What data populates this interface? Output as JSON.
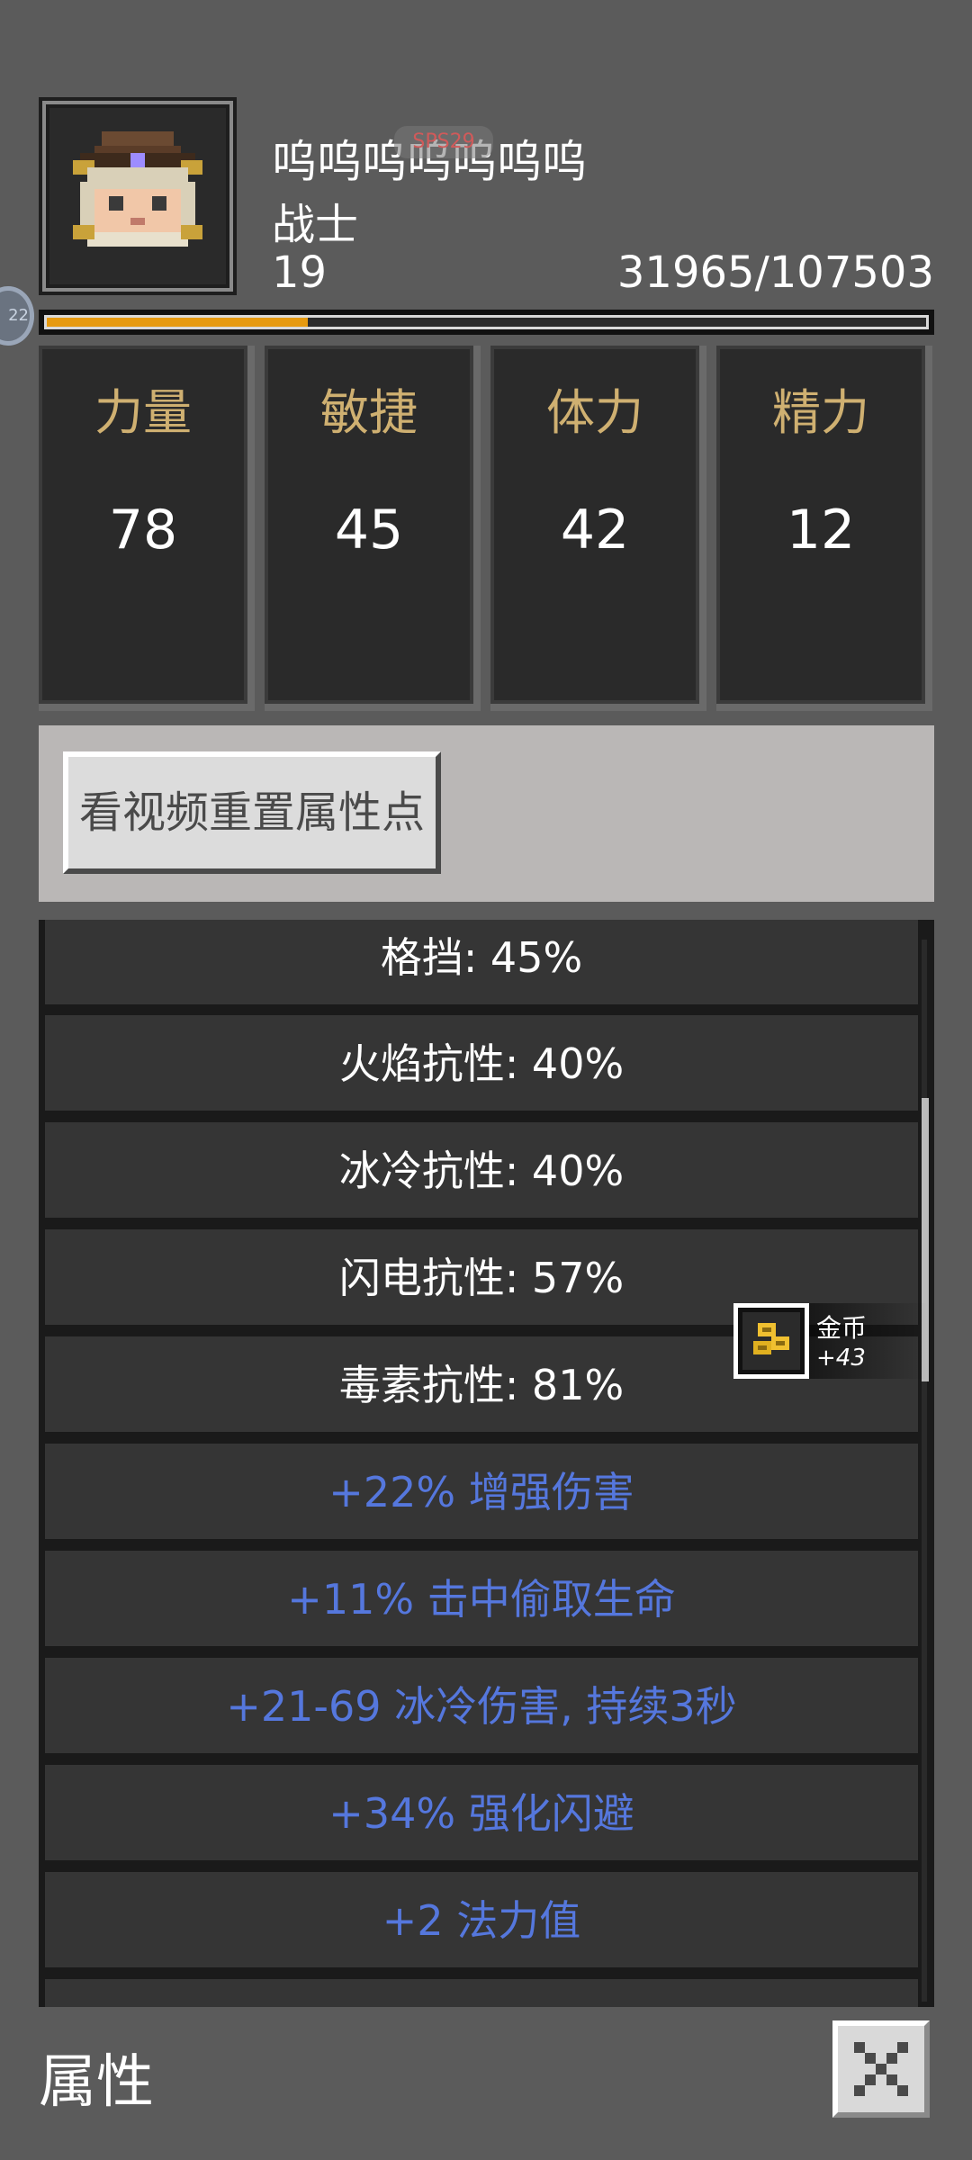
{
  "character": {
    "name": "呜呜呜呜呜呜呜",
    "watermark": "SPS29",
    "class": "战士",
    "level": "19",
    "experience": "31965/107503",
    "experience_fraction": 0.297
  },
  "side_badge": {
    "label": "22"
  },
  "stats": [
    {
      "label": "力量",
      "value": "78"
    },
    {
      "label": "敏捷",
      "value": "45"
    },
    {
      "label": "体力",
      "value": "42"
    },
    {
      "label": "精力",
      "value": "12"
    }
  ],
  "reset_button": {
    "label": "看视频重置属性点"
  },
  "attributes": [
    {
      "text": "格挡: 45%",
      "style": "white"
    },
    {
      "text": "火焰抗性: 40%",
      "style": "white"
    },
    {
      "text": "冰冷抗性: 40%",
      "style": "white"
    },
    {
      "text": "闪电抗性: 57%",
      "style": "white"
    },
    {
      "text": "毒素抗性: 81%",
      "style": "white"
    },
    {
      "text": "+22% 增强伤害",
      "style": "blue"
    },
    {
      "text": "+11% 击中偷取生命",
      "style": "blue"
    },
    {
      "text": "+21-69 冰冷伤害, 持续3秒",
      "style": "blue"
    },
    {
      "text": "+34% 强化闪避",
      "style": "blue"
    },
    {
      "text": "+2 法力值",
      "style": "blue"
    }
  ],
  "toast": {
    "title": "金币",
    "amount": "+43",
    "icon": "gold-coins-icon"
  },
  "footer": {
    "title": "属性",
    "close_icon": "close-icon"
  },
  "colors": {
    "background": "#5b5b5b",
    "stat_label": "#cfb071",
    "magic_text": "#5577dd",
    "xp_fill": "#e69a10"
  }
}
